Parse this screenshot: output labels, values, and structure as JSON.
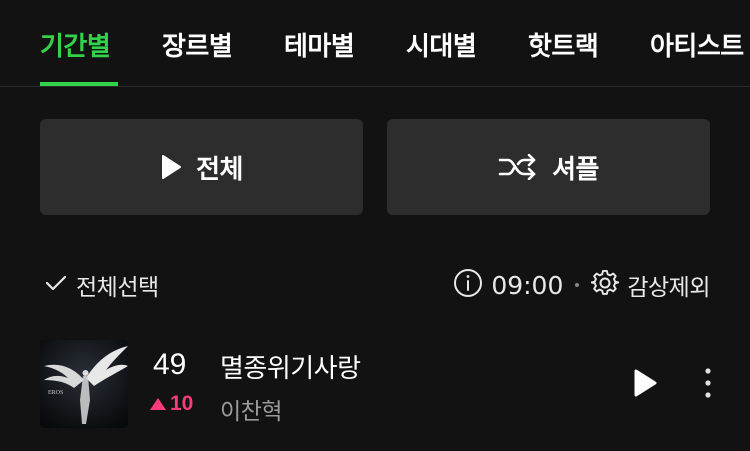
{
  "tabs": [
    {
      "label": "기간별",
      "active": true
    },
    {
      "label": "장르별"
    },
    {
      "label": "테마별"
    },
    {
      "label": "시대별"
    },
    {
      "label": "핫트랙"
    },
    {
      "label": "아티스트"
    }
  ],
  "actions": {
    "play_all_label": "전체",
    "shuffle_label": "셔플"
  },
  "select_all": {
    "label": "전체선택"
  },
  "timer": {
    "time": "09:00"
  },
  "exclude": {
    "label": "감상제외"
  },
  "track": {
    "rank": "49",
    "rank_change": "10",
    "rank_change_direction": "up",
    "title": "멸종위기사랑",
    "artist": "이찬혁",
    "album_art_text": "EROS"
  },
  "colors": {
    "accent": "#33d24b",
    "rank_up": "#ff3b7a",
    "background": "#121212",
    "button_bg": "#2d2d2d"
  }
}
